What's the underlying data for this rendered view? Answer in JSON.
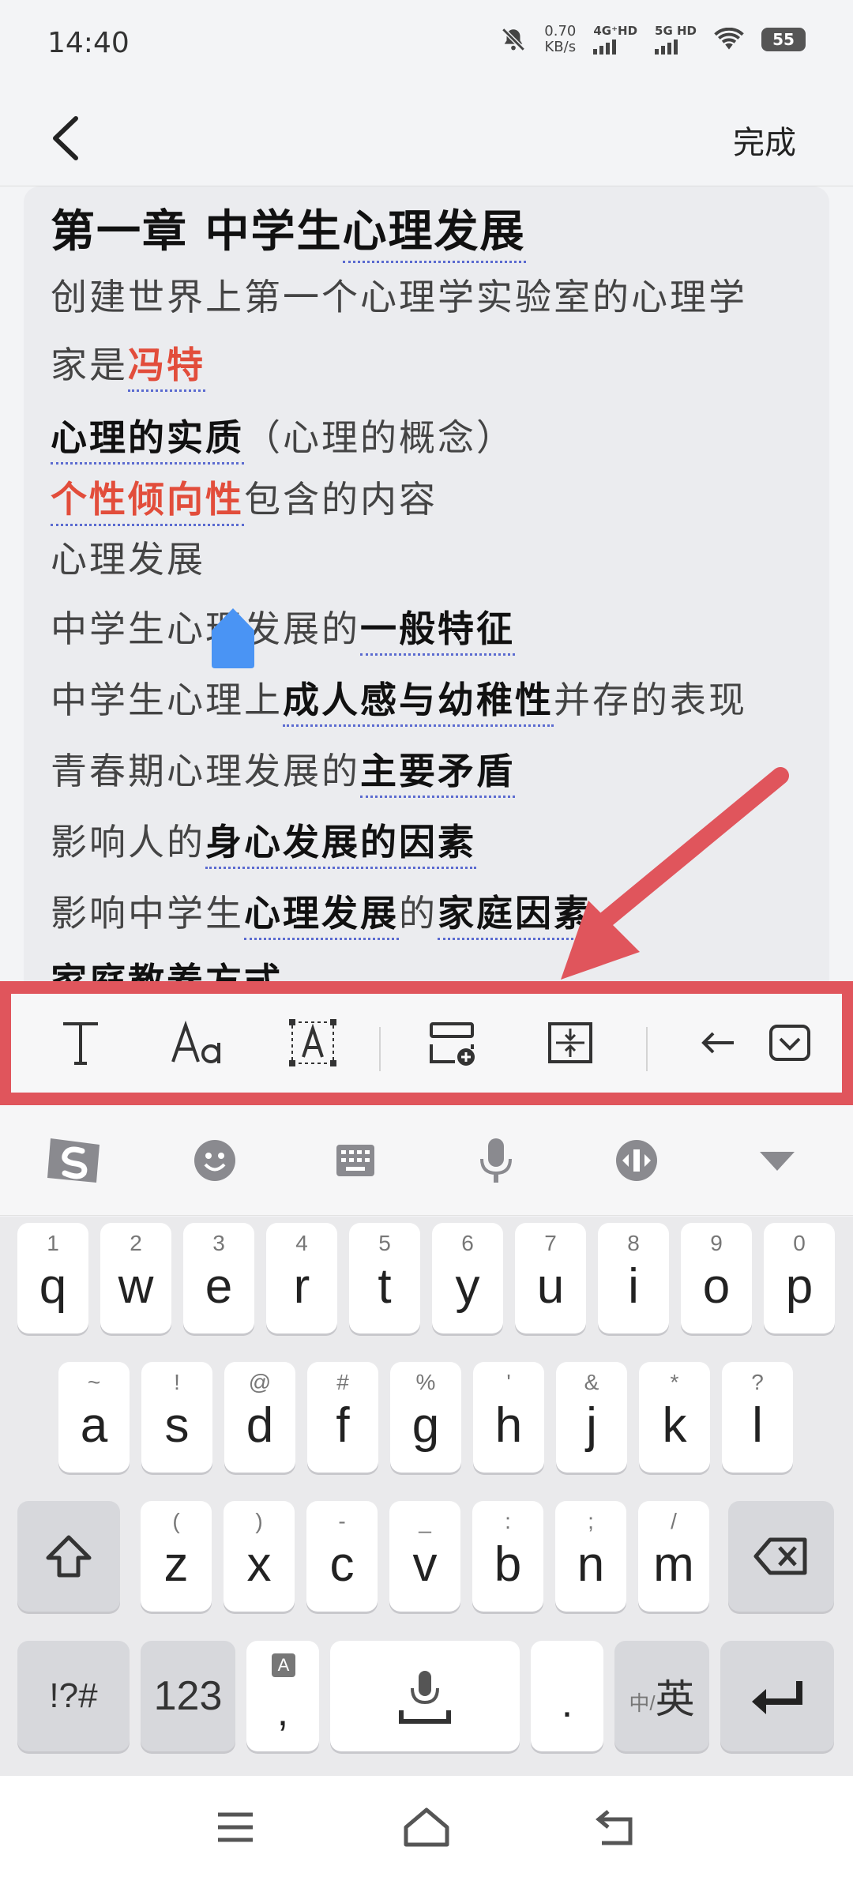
{
  "status": {
    "time": "14:40",
    "speed_value": "0.70",
    "speed_unit": "KB/s",
    "net1": "4G⁺HD",
    "net2": "5G HD",
    "battery": "55"
  },
  "header": {
    "done_label": "完成"
  },
  "editor": {
    "title": {
      "a": "第一章 中学生",
      "b": "心理发展"
    },
    "line1": "创建世界上第一个心理学实验室的心理学",
    "line2": {
      "a": "家是",
      "b": "冯特"
    },
    "line3": {
      "a": "心理的实质",
      "b": "（心理的概念）"
    },
    "line4": {
      "a": "个性倾向性",
      "b": "包含的内容"
    },
    "line5": "心理发展",
    "line6": {
      "a": "中学生心理发展的",
      "b": "一般特征"
    },
    "line7": {
      "a": "中学生心理上",
      "b": "成人感与幼稚性",
      "c": "并存的表现"
    },
    "line8": {
      "a": "青春期心理发展的",
      "b": "主要矛盾"
    },
    "line9": {
      "a": "影响人的",
      "b": "身心发展的因素"
    },
    "line10": {
      "a": "影响中学生",
      "b": "心理发展",
      "c": "的",
      "d": "家庭因素"
    },
    "line11": "家庭教养方式"
  },
  "toolbar": {
    "icons": [
      "text-style-icon",
      "font-size-icon",
      "text-box-icon",
      "insert-block-icon",
      "spacing-icon",
      "undo-icon",
      "collapse-icon"
    ]
  },
  "ime": {
    "icons": [
      "sogou-logo-icon",
      "emoji-icon",
      "keyboard-icon",
      "microphone-icon",
      "clipboard-icon",
      "hide-keyboard-icon"
    ]
  },
  "keyboard": {
    "row1": [
      {
        "k": "q",
        "h": "1"
      },
      {
        "k": "w",
        "h": "2"
      },
      {
        "k": "e",
        "h": "3"
      },
      {
        "k": "r",
        "h": "4"
      },
      {
        "k": "t",
        "h": "5"
      },
      {
        "k": "y",
        "h": "6"
      },
      {
        "k": "u",
        "h": "7"
      },
      {
        "k": "i",
        "h": "8"
      },
      {
        "k": "o",
        "h": "9"
      },
      {
        "k": "p",
        "h": "0"
      }
    ],
    "row2": [
      {
        "k": "a",
        "h": "~"
      },
      {
        "k": "s",
        "h": "!"
      },
      {
        "k": "d",
        "h": "@"
      },
      {
        "k": "f",
        "h": "#"
      },
      {
        "k": "g",
        "h": "%"
      },
      {
        "k": "h",
        "h": "'"
      },
      {
        "k": "j",
        "h": "&"
      },
      {
        "k": "k",
        "h": "*"
      },
      {
        "k": "l",
        "h": "?"
      }
    ],
    "row3": [
      {
        "k": "z",
        "h": "("
      },
      {
        "k": "x",
        "h": ")"
      },
      {
        "k": "c",
        "h": "-"
      },
      {
        "k": "v",
        "h": "_"
      },
      {
        "k": "b",
        "h": ":"
      },
      {
        "k": "n",
        "h": ";"
      },
      {
        "k": "m",
        "h": "/"
      }
    ],
    "symbols_label": "!?#",
    "numbers_label": "123",
    "comma_label": ",",
    "comma_hint": "A",
    "period_label": ".",
    "lang_small": "中/",
    "lang_big": "英"
  }
}
